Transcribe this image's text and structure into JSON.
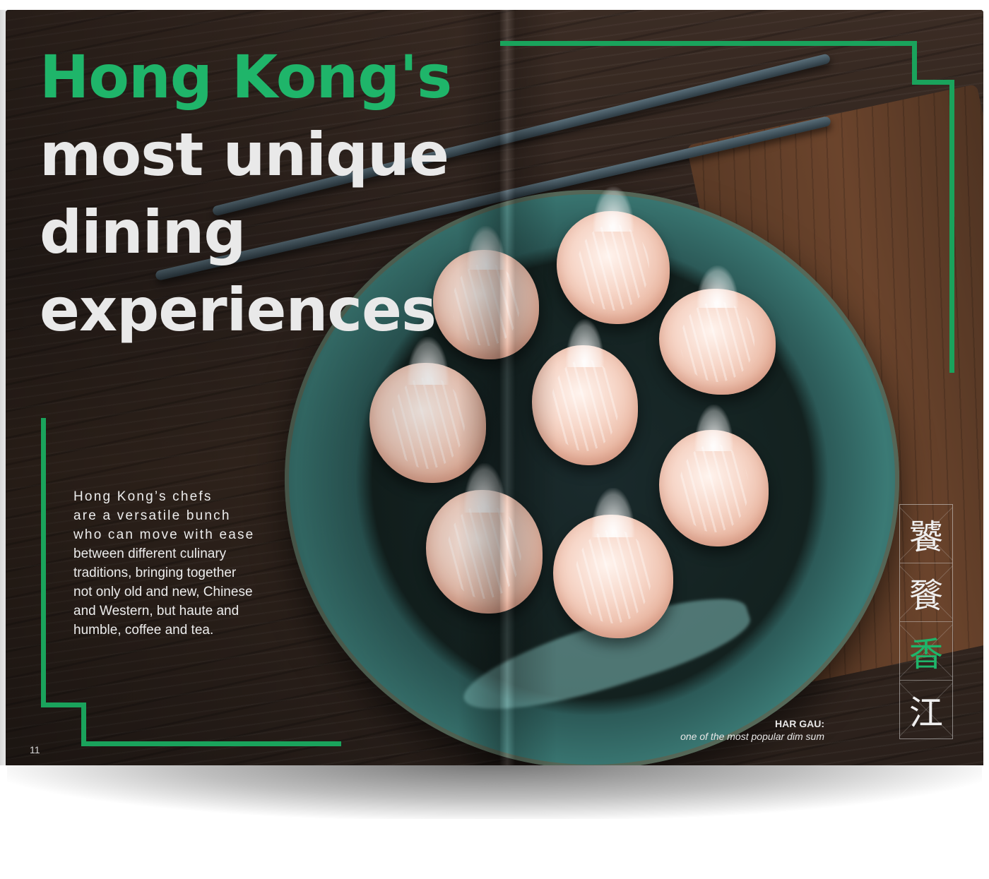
{
  "headline": {
    "line1": "Hong Kong's",
    "line2": "most unique",
    "line3": "dining",
    "line4": "experiences"
  },
  "body": {
    "lines": [
      "Hong Kong’s chefs",
      "are a versatile bunch",
      "who can move with ease",
      "between different culinary",
      "traditions, bringing together",
      "not only old and new, Chinese",
      "and Western, but haute and",
      "humble, coffee and tea."
    ]
  },
  "page_number": "11",
  "caption": {
    "title": "HAR GAU:",
    "subtitle": "one of the most popular dim sum"
  },
  "vertical_characters": [
    "饕",
    "餮",
    "香",
    "江"
  ],
  "colors": {
    "accent_green": "#1fb56a",
    "frame_green": "#1aa35c",
    "headline_white": "#e9e9e9"
  }
}
